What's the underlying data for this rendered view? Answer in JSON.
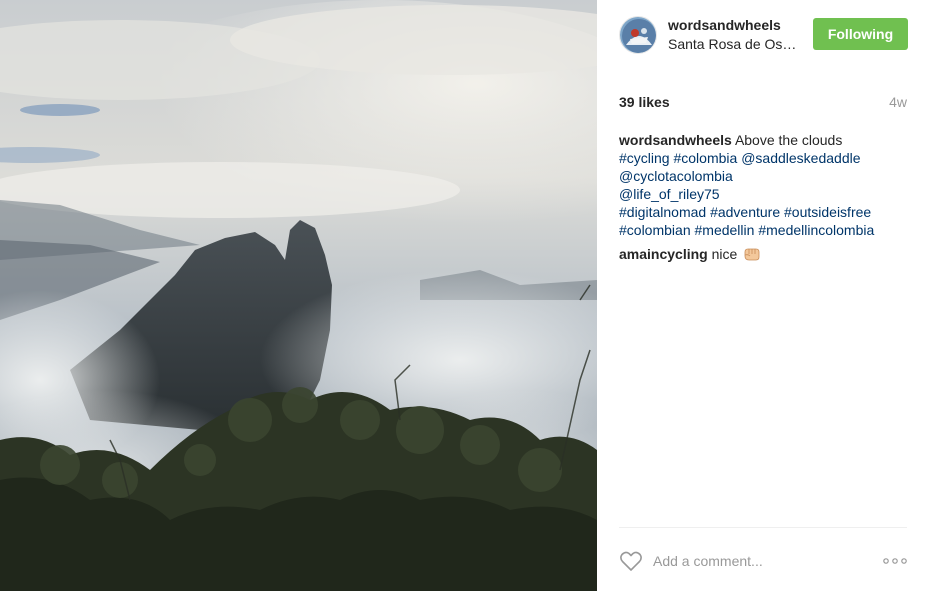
{
  "post": {
    "image_alt": "Mountain peak rising above the clouds with trees in foreground"
  },
  "header": {
    "username": "wordsandwheels",
    "location": "Santa Rosa de Os…",
    "follow_label": "Following",
    "follow_color": "#70c050"
  },
  "stats": {
    "likes": "39 likes",
    "time": "4w"
  },
  "caption": {
    "user": "wordsandwheels",
    "text": "Above the clouds",
    "tags": [
      "#cycling",
      "#colombia",
      "@saddleskedaddle",
      "@cyclotacolombia",
      "@life_of_riley75",
      "#digitalnomad",
      "#adventure",
      "#outsideisfree",
      "#colombian",
      "#medellin",
      "#medellincolombia"
    ]
  },
  "comments": [
    {
      "user": "amaincycling",
      "text": "nice",
      "emoji": "fist-bump-icon"
    }
  ],
  "footer": {
    "comment_placeholder": "Add a comment...",
    "like_icon": "heart-icon",
    "more_icon": "more-options-icon"
  },
  "colors": {
    "link": "#003569",
    "muted": "#999999",
    "text": "#262626"
  }
}
